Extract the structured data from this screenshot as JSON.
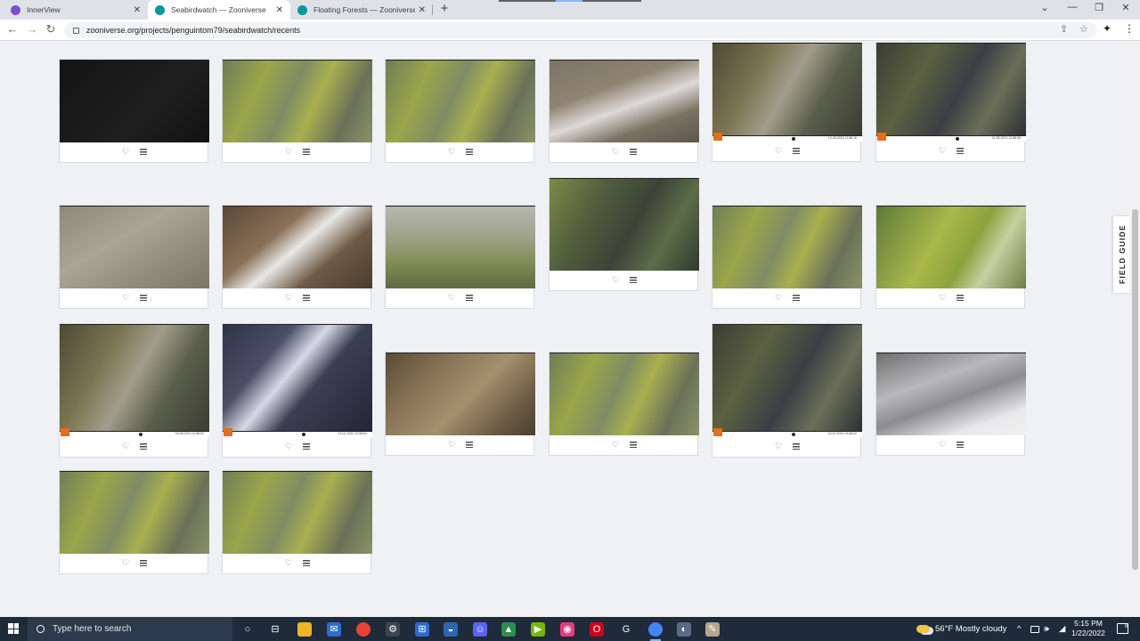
{
  "browser": {
    "tabs": [
      {
        "label": "InnerView",
        "close": "✕",
        "active": false,
        "favicon_color": "#7b4fd0"
      },
      {
        "label": "Seabirdwatch — Zooniverse",
        "close": "✕",
        "active": true,
        "favicon_color": "#00979d"
      },
      {
        "label": "Floating Forests — Zooniverse",
        "close": "✕",
        "active": false,
        "favicon_color": "#00979d"
      }
    ],
    "new_tab": "+",
    "window_controls": {
      "tab_search": "⌄",
      "minimize": "—",
      "maximize": "❐",
      "close": "✕"
    },
    "nav": {
      "back": "←",
      "forward": "→",
      "reload": "↻"
    },
    "url": "zooniverse.org/projects/penguintom79/seabirdwatch/recents",
    "omnibox_icons": {
      "share": "⇪",
      "bookmark": "☆"
    },
    "extension_icon": "✦",
    "menu_icon": "⋮"
  },
  "page": {
    "field_guide_label": "FIELD GUIDE",
    "card_icons": {
      "favorite": "♡",
      "collect": "collections-icon"
    },
    "cards": [
      {
        "scene": "night-dark"
      },
      {
        "scene": "green-cliff"
      },
      {
        "scene": "green-cliff"
      },
      {
        "scene": "snowy-rock"
      },
      {
        "scene": "tall-cliff-birds",
        "stamp": "10-08-2020 11:58:16"
      },
      {
        "scene": "tall-dark-cliff",
        "stamp": "11-08-2020 12:58:38"
      },
      {
        "scene": "grey-rock"
      },
      {
        "scene": "brown-snow-cliff"
      },
      {
        "scene": "foggy-green"
      },
      {
        "scene": "tall-green-cliff"
      },
      {
        "scene": "green-cliff"
      },
      {
        "scene": "bright-green"
      },
      {
        "scene": "tall-cliff-birds",
        "stamp": "04-08-2022 11:58:52"
      },
      {
        "scene": "tall-snow-dark",
        "stamp": "12-01-2020 12:58:51"
      },
      {
        "scene": "brown-rock"
      },
      {
        "scene": "green-cliff"
      },
      {
        "scene": "tall-dark-cliff",
        "stamp": "10-01-2019 13:58:42"
      },
      {
        "scene": "white-snow-rock"
      },
      {
        "scene": "green-cliff"
      },
      {
        "scene": "green-cliff"
      }
    ]
  },
  "taskbar": {
    "search_placeholder": "Type here to search",
    "weather": "56°F  Mostly cloudy",
    "time": "5:15 PM",
    "date": "1/22/2022",
    "notification_count": "9",
    "tray_icons": {
      "chevron": "^",
      "volume": "🕪",
      "wifi": "◢"
    },
    "apps": [
      "cortana-icon",
      "task-view-icon",
      "file-explorer-icon",
      "mail-icon",
      "chrome-icon",
      "steam-icon",
      "microsoft-store-icon",
      "steam-client-icon",
      "discord-icon",
      "app-icon",
      "nvidia-icon",
      "color-wheel-icon",
      "opera-icon",
      "g-icon",
      "chrome-active-icon",
      "vpn-icon",
      "notepad-icon"
    ]
  }
}
